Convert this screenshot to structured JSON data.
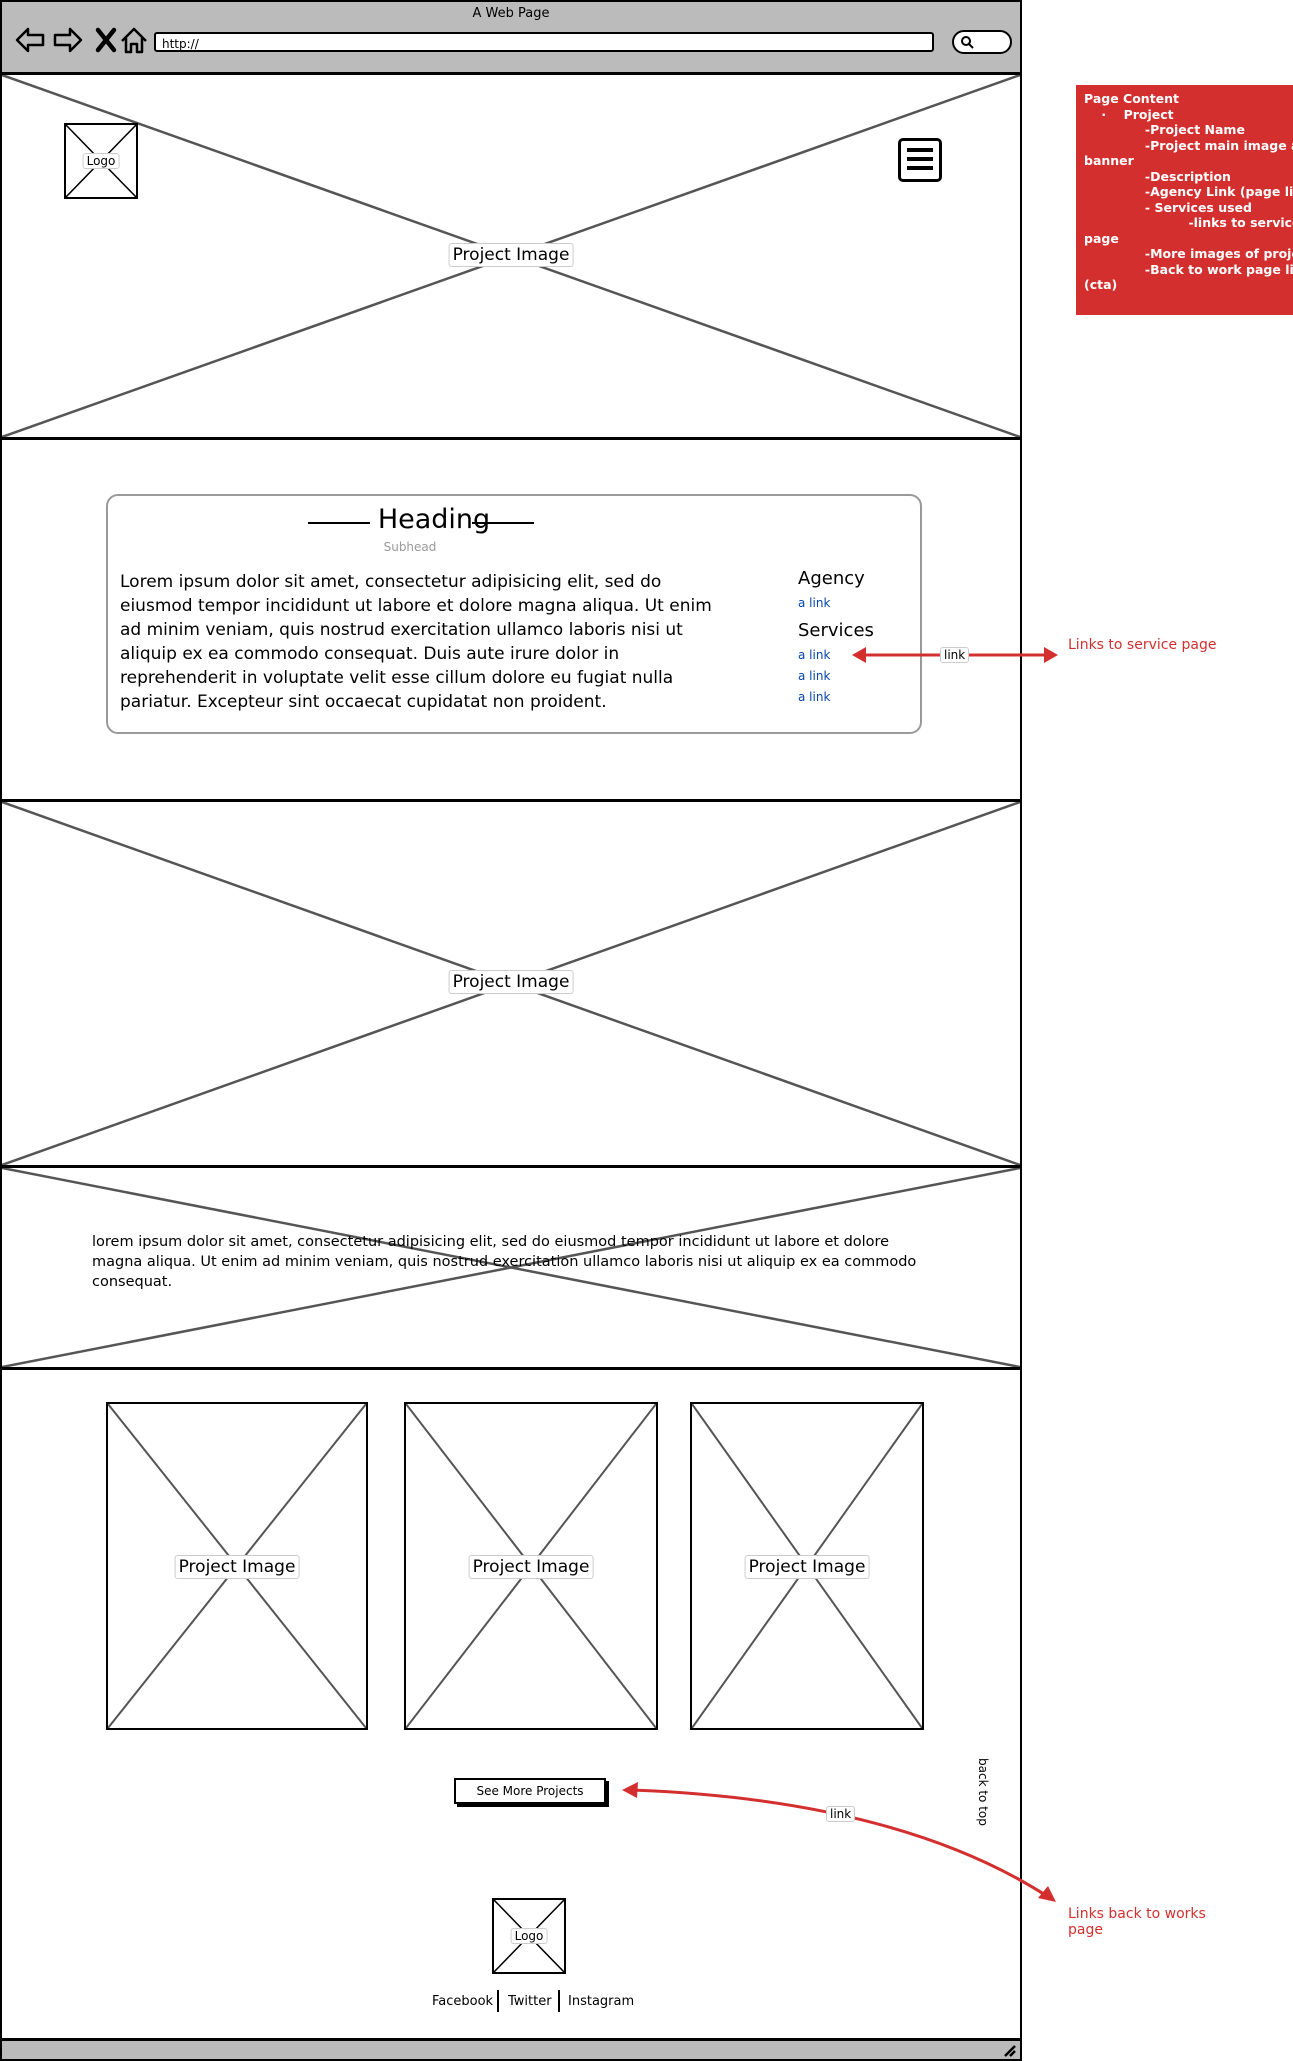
{
  "window": {
    "title": "A Web Page",
    "url": "http://"
  },
  "nav_icons": [
    "back-arrow-icon",
    "forward-arrow-icon",
    "close-icon",
    "home-icon"
  ],
  "hero": {
    "logo_label": "Logo",
    "image_label": "Project Image",
    "menu_icon": "hamburger-menu-icon"
  },
  "intro": {
    "heading": "Heading",
    "subhead": "Subhead",
    "body": "Lorem ipsum dolor sit amet, consectetur adipisicing elit, sed do eiusmod tempor incididunt ut labore et dolore magna aliqua. Ut enim ad minim veniam, quis nostrud exercitation ullamco laboris nisi ut aliquip ex ea commodo consequat. Duis aute irure dolor in reprehenderit in voluptate velit esse cillum dolore eu fugiat nulla pariatur. Excepteur sint occaecat cupidatat non proident.",
    "agency_heading": "Agency",
    "agency_link": "a link",
    "services_heading": "Services",
    "service_links": [
      "a link",
      "a link",
      "a link"
    ]
  },
  "gallery_image": {
    "label": "Project Image"
  },
  "quote_section": {
    "text": "lorem ipsum dolor sit amet, consectetur adipisicing elit, sed do eiusmod tempor incididunt ut labore et dolore magna aliqua. Ut enim ad minim veniam, quis nostrud exercitation ullamco laboris nisi ut aliquip ex ea commodo consequat."
  },
  "more_projects": {
    "tiles": [
      "Project Image",
      "Project Image",
      "Project Image"
    ],
    "cta_label": "See More Projects",
    "back_to_top": "back to top"
  },
  "footer": {
    "logo_label": "Logo",
    "social": [
      "Facebook",
      "Twitter",
      "Instagram"
    ]
  },
  "annotations": {
    "page_content_title": "Page Content",
    "page_content_lines": [
      "    ·    Project",
      "              -Project Name",
      "              -Project main image as",
      "banner",
      "              -Description",
      "              -Agency Link (page link)",
      "              - Services used",
      "                        -links to service",
      "page",
      "              -More images of project",
      "              -Back to work page link",
      "(cta)"
    ],
    "services_link_pill": "link",
    "services_note": "Links to service page",
    "cta_link_pill": "link",
    "cta_note_line1": "Links back to works",
    "cta_note_line2": "page",
    "note_color": "#d32f2f"
  }
}
